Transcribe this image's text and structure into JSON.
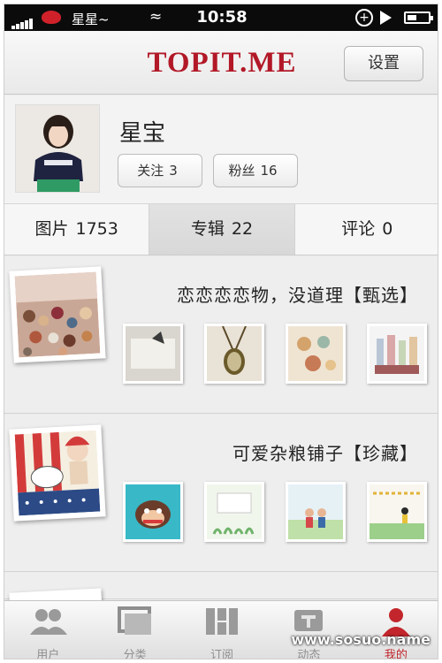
{
  "status_bar": {
    "carrier": "星星~",
    "time": "10:58"
  },
  "navbar": {
    "logo": "TOPIT.ME",
    "settings_label": "设置"
  },
  "profile": {
    "username": "星宝",
    "follow_label": "关注",
    "follow_count": "3",
    "fans_label": "粉丝",
    "fans_count": "16"
  },
  "tabs": [
    {
      "label": "图片",
      "count": "1753"
    },
    {
      "label": "专辑",
      "count": "22"
    },
    {
      "label": "评论",
      "count": "0"
    }
  ],
  "albums": [
    {
      "title": "恋恋恋恋物，没道理【甄选】"
    },
    {
      "title": "可爱杂粮铺子【珍藏】"
    }
  ],
  "tabbar": {
    "items": [
      {
        "label": "用户",
        "icon": "users-icon"
      },
      {
        "label": "分类",
        "icon": "category-icon"
      },
      {
        "label": "订阅",
        "icon": "subscribe-icon"
      },
      {
        "label": "动态",
        "icon": "activity-icon"
      },
      {
        "label": "我的",
        "icon": "me-icon"
      }
    ],
    "watermark": "www.sosuo.name"
  },
  "colors": {
    "brand_red": "#b21827",
    "active_tab_red": "#c2262c"
  }
}
